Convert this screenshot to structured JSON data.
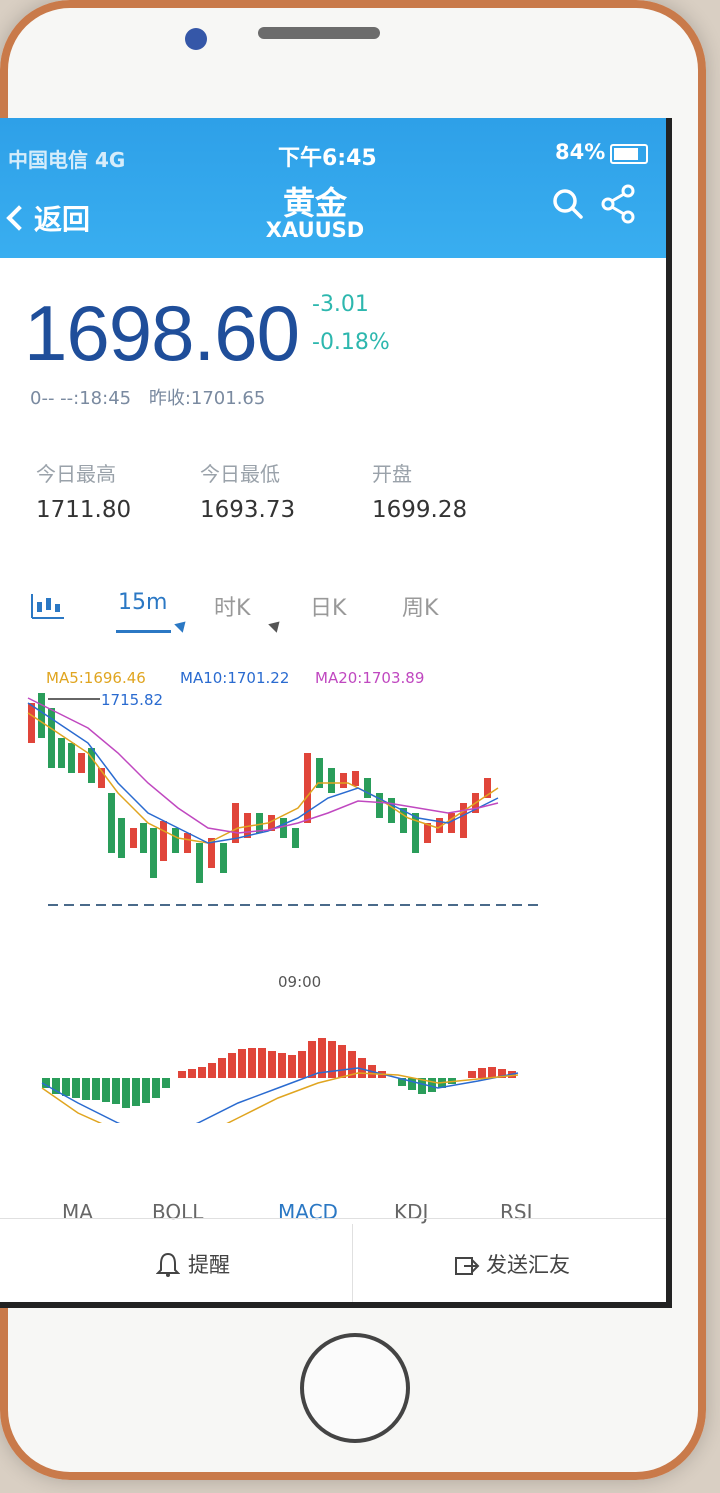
{
  "status": {
    "carrier": "中国电信 4G",
    "time": "下午6:45",
    "battery": "84%"
  },
  "header": {
    "back_label": "返回",
    "title": "黄金",
    "subtitle": "XAUUSD"
  },
  "quote": {
    "price": "1698.60",
    "change": "-3.01",
    "change_pct": "-0.18%",
    "time": "0-- --:18:45",
    "prev_close_label": "昨收:1701.65"
  },
  "stats": [
    {
      "label": "今日最高",
      "value": "1711.80"
    },
    {
      "label": "今日最低",
      "value": "1693.73"
    },
    {
      "label": "开盘",
      "value": "1699.28"
    }
  ],
  "period_tabs": [
    {
      "label": "15m",
      "active": true
    },
    {
      "label": "时K",
      "active": false
    },
    {
      "label": "日K",
      "active": false
    },
    {
      "label": "周K",
      "active": false
    }
  ],
  "chart_labels": {
    "ma5": "MA5:1696.46",
    "ma10": "MA10:1701.22",
    "ma20": "MA20:1703.89",
    "high": "1715.82",
    "time": "09:00"
  },
  "indicator_tabs": [
    {
      "label": "MA",
      "active": false
    },
    {
      "label": "BOLL",
      "active": false
    },
    {
      "label": "MACD",
      "active": true
    },
    {
      "label": "KDJ",
      "active": false
    },
    {
      "label": "RSI",
      "active": false
    }
  ],
  "actions": {
    "remind": "提醒",
    "send": "发送汇友"
  },
  "colors": {
    "up": "#e0453a",
    "down": "#2a9d5a",
    "accent": "#2b78c4",
    "header": "#34a8ee"
  }
}
